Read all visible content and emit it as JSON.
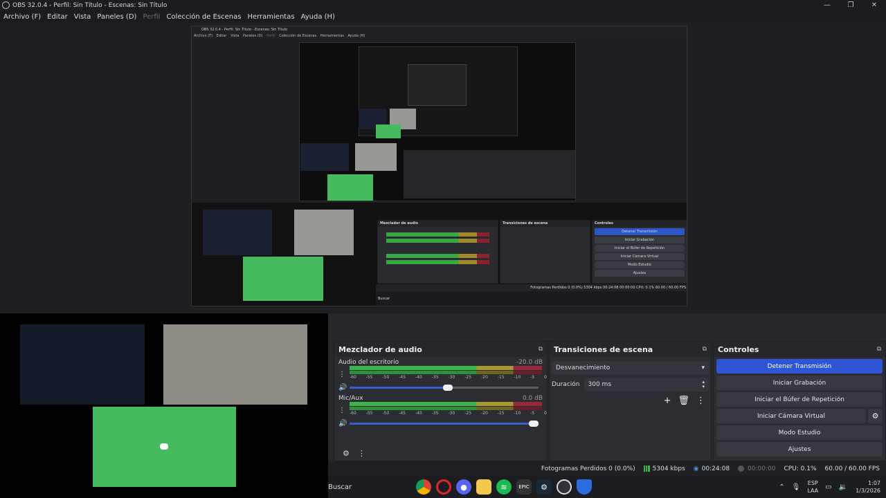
{
  "window": {
    "title": "OBS 32.0.4 - Perfil: Sin Título - Escenas: Sin Título",
    "controls": [
      "—",
      "❐",
      "✕"
    ]
  },
  "menu": [
    {
      "label": "Archivo (F)",
      "disabled": false
    },
    {
      "label": "Editar",
      "disabled": false
    },
    {
      "label": "Vista",
      "disabled": false
    },
    {
      "label": "Paneles (D)",
      "disabled": false
    },
    {
      "label": "Perfil",
      "disabled": true
    },
    {
      "label": "Colección de Escenas",
      "disabled": false
    },
    {
      "label": "Herramientas",
      "disabled": false
    },
    {
      "label": "Ayuda (H)",
      "disabled": false
    }
  ],
  "nested": {
    "title": "OBS 32.0.4 - Perfil: Sin Título - Escenas: Sin Título",
    "menu": [
      "Archivo (F)",
      "Editar",
      "Vista",
      "Paneles (D)",
      "Perfil",
      "Colección de Escenas",
      "Herramientas",
      "Ayuda (H)"
    ],
    "docks": {
      "mixer": "Mezclador de audio",
      "transitions": "Transiciones de escena",
      "controls": "Controles"
    },
    "buttons": [
      "Detener Transmisión",
      "Iniciar Grabación",
      "Iniciar el Búfer de Repetición",
      "Iniciar Cámara Virtual",
      "Modo Estudio",
      "Ajustes"
    ],
    "status": "Fotogramas Perdidos 0 (0.0%)   5304 kbps   00:24:08   00:00:00   CPU: 0.1%   60.00 / 60.00 FPS",
    "search": "Buscar"
  },
  "mixer": {
    "title": "Mezclador de audio",
    "ticks": [
      "-60",
      "-55",
      "-50",
      "-45",
      "-40",
      "-35",
      "-30",
      "-25",
      "-20",
      "-15",
      "-10",
      "-5",
      "0"
    ],
    "channels": [
      {
        "name": "Audio del escritorio",
        "db": "-20.0 dB",
        "volume": 0.52
      },
      {
        "name": "Mic/Aux",
        "db": "0.0 dB",
        "volume": 1.0
      }
    ]
  },
  "transitions": {
    "title": "Transiciones de escena",
    "selected": "Desvanecimiento",
    "duration_label": "Duración",
    "duration_value": "300 ms"
  },
  "controls": {
    "title": "Controles",
    "stop_stream": "Detener Transmisión",
    "start_recording": "Iniciar Grabación",
    "start_replay": "Iniciar el Búfer de Repetición",
    "start_virtualcam": "Iniciar Cámara Virtual",
    "studio_mode": "Modo Estudio",
    "settings": "Ajustes"
  },
  "status": {
    "dropped": "Fotogramas Perdidos 0 (0.0%)",
    "bitrate": "5304 kbps",
    "stream_time": "00:24:08",
    "record_time": "00:00:00",
    "cpu": "CPU: 0.1%",
    "fps": "60.00 / 60.00 FPS",
    "colors": {
      "green": "#3bb54a",
      "blue": "#2f55d4"
    }
  },
  "taskbar": {
    "search": "Buscar",
    "lang_top": "ESP",
    "lang_bottom": "LAA",
    "time": "1:07",
    "date": "1/3/2026"
  }
}
